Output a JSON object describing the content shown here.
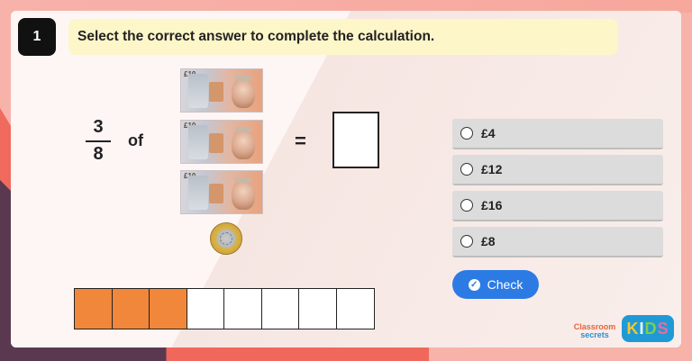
{
  "question": {
    "number": "1",
    "prompt": "Select the correct answer to complete the calculation."
  },
  "calculation": {
    "numerator": "3",
    "denominator": "8",
    "of_word": "of",
    "equals": "=",
    "notes": [
      {
        "denomination": "£10"
      },
      {
        "denomination": "£10"
      },
      {
        "denomination": "£10"
      }
    ],
    "coin": "£2 coin"
  },
  "bar_model": {
    "total_parts": 8,
    "shaded_parts": 3,
    "shade_color": "#f0873a"
  },
  "options": [
    {
      "label": "£4"
    },
    {
      "label": "£12"
    },
    {
      "label": "£16"
    },
    {
      "label": "£8"
    }
  ],
  "check_button": {
    "label": "Check"
  },
  "branding": {
    "classroom": "Classroom",
    "secrets": "secrets",
    "kids_letters": [
      "K",
      "I",
      "D",
      "S"
    ]
  },
  "colors": {
    "accent_blue": "#2c7be5",
    "prompt_bg": "#fdf6c9",
    "option_bg": "#dcdcdc",
    "dark_plum": "#5a3950",
    "coral": "#f06a5d"
  }
}
